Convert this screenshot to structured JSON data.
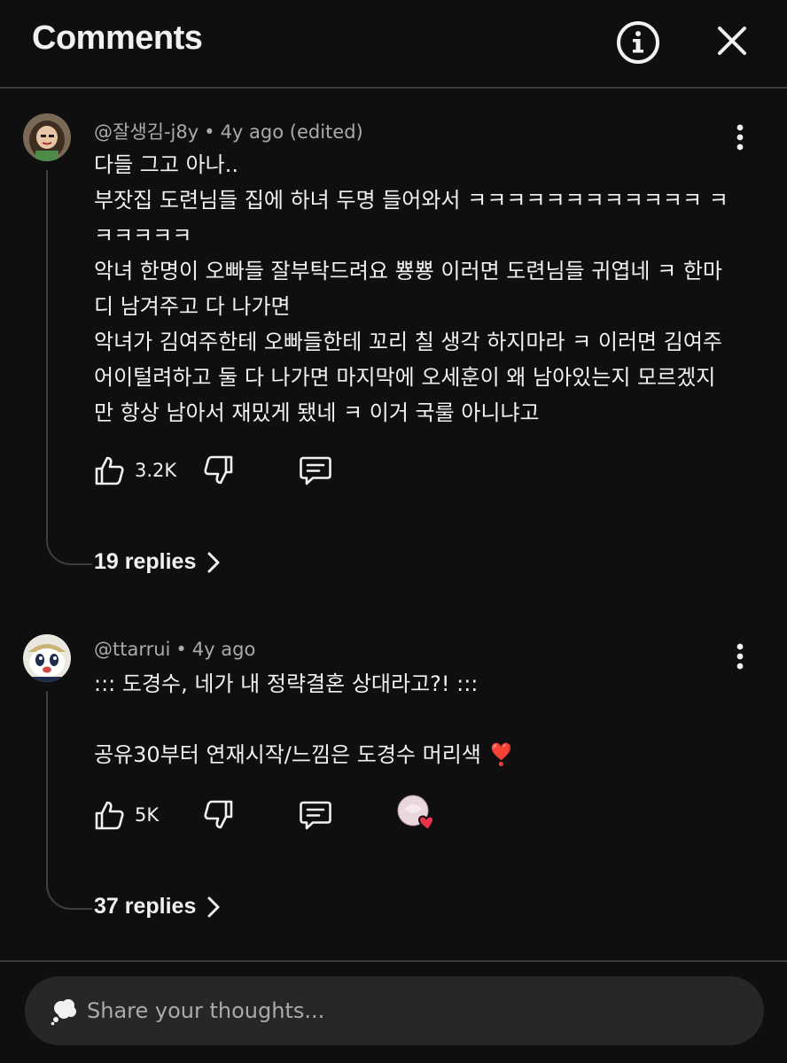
{
  "header": {
    "title": "Comments",
    "info_icon": "info-circle-icon",
    "close_icon": "close-icon"
  },
  "comments": [
    {
      "author": "@잘생김-j8y",
      "time": "4y ago",
      "edited": "(edited)",
      "lines": [
        "다들 그고 아나..",
        "부잣집 도련님들 집에 하녀 두명 들어와서 ㅋㅋㅋㅋㅋㅋㅋㅋㅋㅋㅋㅋ ㅋㅋㅋㅋㅋㅋ",
        "악녀 한명이 오빠들 잘부탁드려요 뿅뿅 이러면 도련님들 귀엽네 ㅋ 한마디 남겨주고 다 나가면",
        "악녀가 김여주한테 오빠들한테 꼬리 칠 생각 하지마라 ㅋ 이러면 김여주 어이털려하고 둘 다 나가면 마지막에 오세훈이 왜 남아있는지 모르겠지만 항상 남아서 재밌게 됐네 ㅋ 이거 국룰 아니냐고"
      ],
      "likes": "3.2K",
      "replies": "19 replies"
    },
    {
      "author": "@ttarrui",
      "time": "4y ago",
      "lines": [
        "::: 도경수, 네가 내 정략결혼 상대라고?! :::",
        "",
        "공유30부터 연재시작/느낌은 도경수 머리색 ❣️"
      ],
      "likes": "5K",
      "replies": "37 replies"
    }
  ],
  "composer": {
    "placeholder": "Share your thoughts..."
  },
  "colors": {
    "background": "#0f0f0f",
    "text": "#f1f1f1",
    "secondary_text": "#aaaaaa",
    "composer_bg": "#272727",
    "heart": "#e8344a"
  }
}
